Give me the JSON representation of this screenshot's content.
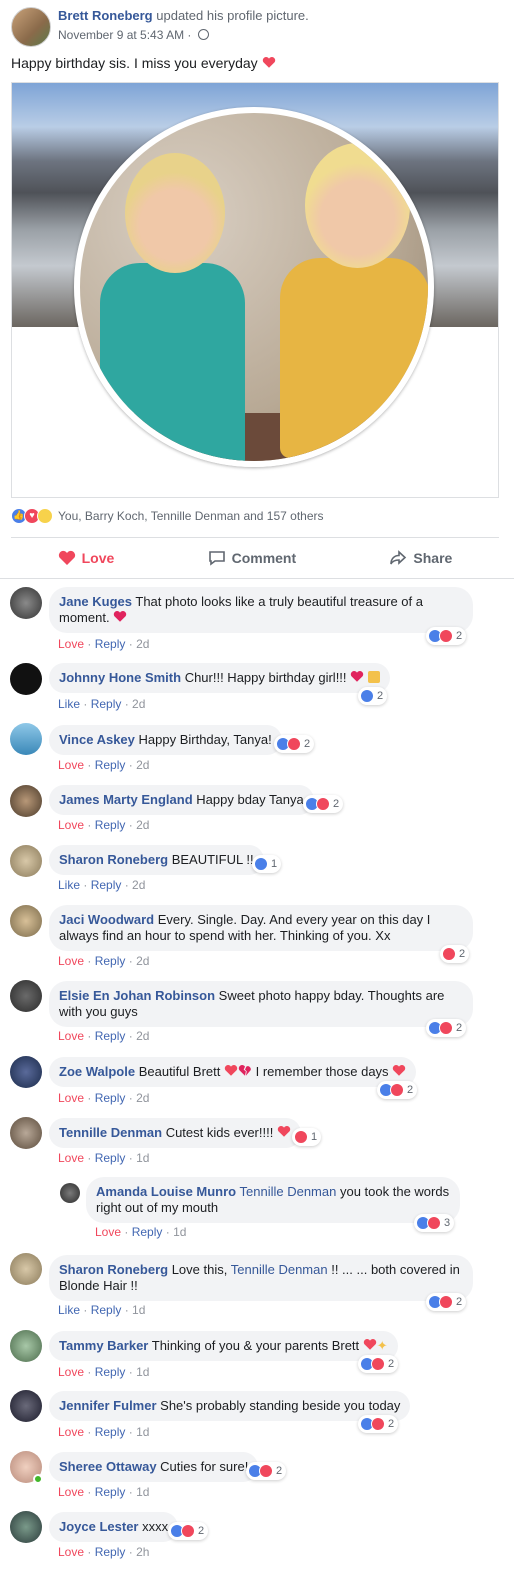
{
  "post": {
    "author": "Brett Roneberg",
    "action": "updated his profile picture.",
    "date": "November 9 at 5:43 AM · ",
    "text": "Happy birthday sis. I miss you everyday"
  },
  "reactions_summary": "You, Barry Koch, Tennille Denman and 157 others",
  "actions": {
    "love": "Love",
    "comment": "Comment",
    "share": "Share"
  },
  "comments": [
    {
      "name": "Jane Kuges",
      "text_1": "That photo looks like a truly beautiful treasure of a",
      "text_2": "moment.",
      "reaction_label": "Love",
      "reply": "Reply",
      "time": "2d",
      "count": "2"
    },
    {
      "name": "Johnny Hone Smith",
      "text_1": "Chur!!! Happy birthday girl!!!",
      "reaction_label": "Like",
      "reply": "Reply",
      "time": "2d",
      "count": "2"
    },
    {
      "name": "Vince Askey",
      "text_1": "Happy Birthday, Tanya!",
      "reaction_label": "Love",
      "reply": "Reply",
      "time": "2d",
      "count": "2"
    },
    {
      "name": "James Marty England",
      "text_1": "Happy bday Tanya",
      "reaction_label": "Love",
      "reply": "Reply",
      "time": "2d",
      "count": "2"
    },
    {
      "name": "Sharon Roneberg",
      "text_1": "BEAUTIFUL !!",
      "reaction_label": "Like",
      "reply": "Reply",
      "time": "2d",
      "count": "1"
    },
    {
      "name": "Jaci Woodward",
      "text_1": "Every. Single. Day. And every year on this day I",
      "text_2": "always find an hour to spend with her. Thinking of you. Xx",
      "reaction_label": "Love",
      "reply": "Reply",
      "time": "2d",
      "count": "2"
    },
    {
      "name": "Elsie En Johan Robinson",
      "text_1": "Sweet photo happy bday. Thoughts are",
      "text_2": "with you guys",
      "reaction_label": "Love",
      "reply": "Reply",
      "time": "2d",
      "count": "2"
    },
    {
      "name": "Zoe Walpole",
      "text_1": "Beautiful Brett",
      "text_1b": "I remember those days",
      "reaction_label": "Love",
      "reply": "Reply",
      "time": "2d",
      "count": "2"
    },
    {
      "name": "Tennille Denman",
      "text_1": "Cutest kids ever!!!!",
      "reaction_label": "Love",
      "reply": "Reply",
      "time": "1d",
      "count": "1"
    },
    {
      "name": "Amanda Louise Munro",
      "mention": "Tennille Denman",
      "text_1": "you took the words",
      "text_2": "right out of my mouth",
      "reaction_label": "Love",
      "reply": "Reply",
      "time": "1d",
      "count": "3"
    },
    {
      "name": "Sharon Roneberg",
      "text_1": "Love this,",
      "mention": "Tennille Denman",
      "text_1b": "!! ... ... both covered in",
      "text_2": "Blonde Hair !!",
      "reaction_label": "Like",
      "reply": "Reply",
      "time": "1d",
      "count": "2"
    },
    {
      "name": "Tammy Barker",
      "text_1": "Thinking of you & your parents Brett",
      "reaction_label": "Love",
      "reply": "Reply",
      "time": "1d",
      "count": "2"
    },
    {
      "name": "Jennifer Fulmer",
      "text_1": "She's probably standing beside you today",
      "reaction_label": "Love",
      "reply": "Reply",
      "time": "1d",
      "count": "2"
    },
    {
      "name": "Sheree Ottaway",
      "text_1": "Cuties for sure!",
      "reaction_label": "Love",
      "reply": "Reply",
      "time": "1d",
      "count": "2"
    },
    {
      "name": "Joyce Lester",
      "text_1": "xxxx",
      "reaction_label": "Love",
      "reply": "Reply",
      "time": "2h",
      "count": "2"
    }
  ],
  "colors": {
    "link": "#365899",
    "love": "#f0475c",
    "like": "#4a7fe8",
    "bubble": "#f2f3f5"
  }
}
